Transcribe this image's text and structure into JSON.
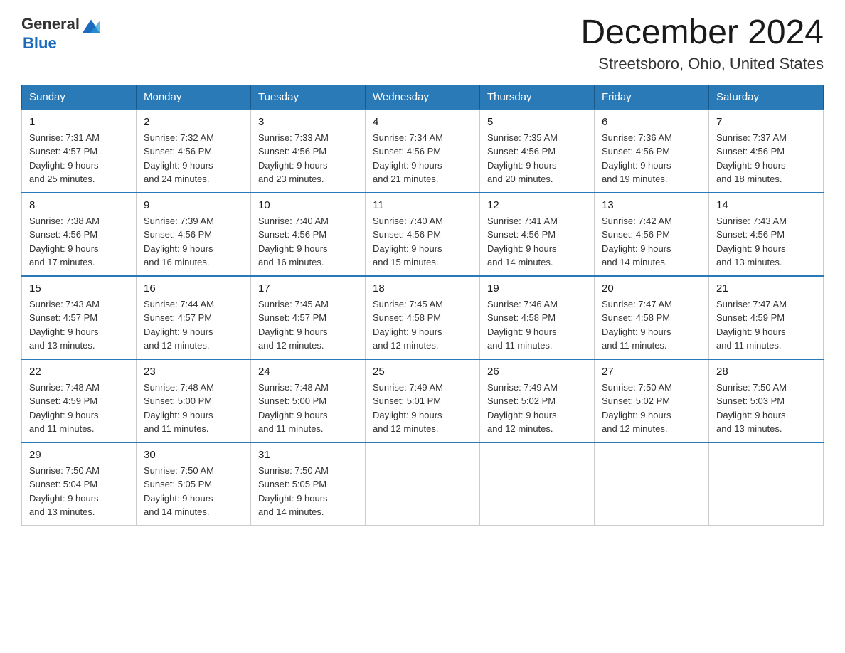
{
  "header": {
    "logo_general": "General",
    "logo_blue": "Blue",
    "title": "December 2024",
    "subtitle": "Streetsboro, Ohio, United States"
  },
  "weekdays": [
    "Sunday",
    "Monday",
    "Tuesday",
    "Wednesday",
    "Thursday",
    "Friday",
    "Saturday"
  ],
  "weeks": [
    [
      {
        "day": "1",
        "sunrise": "7:31 AM",
        "sunset": "4:57 PM",
        "daylight": "9 hours and 25 minutes."
      },
      {
        "day": "2",
        "sunrise": "7:32 AM",
        "sunset": "4:56 PM",
        "daylight": "9 hours and 24 minutes."
      },
      {
        "day": "3",
        "sunrise": "7:33 AM",
        "sunset": "4:56 PM",
        "daylight": "9 hours and 23 minutes."
      },
      {
        "day": "4",
        "sunrise": "7:34 AM",
        "sunset": "4:56 PM",
        "daylight": "9 hours and 21 minutes."
      },
      {
        "day": "5",
        "sunrise": "7:35 AM",
        "sunset": "4:56 PM",
        "daylight": "9 hours and 20 minutes."
      },
      {
        "day": "6",
        "sunrise": "7:36 AM",
        "sunset": "4:56 PM",
        "daylight": "9 hours and 19 minutes."
      },
      {
        "day": "7",
        "sunrise": "7:37 AM",
        "sunset": "4:56 PM",
        "daylight": "9 hours and 18 minutes."
      }
    ],
    [
      {
        "day": "8",
        "sunrise": "7:38 AM",
        "sunset": "4:56 PM",
        "daylight": "9 hours and 17 minutes."
      },
      {
        "day": "9",
        "sunrise": "7:39 AM",
        "sunset": "4:56 PM",
        "daylight": "9 hours and 16 minutes."
      },
      {
        "day": "10",
        "sunrise": "7:40 AM",
        "sunset": "4:56 PM",
        "daylight": "9 hours and 16 minutes."
      },
      {
        "day": "11",
        "sunrise": "7:40 AM",
        "sunset": "4:56 PM",
        "daylight": "9 hours and 15 minutes."
      },
      {
        "day": "12",
        "sunrise": "7:41 AM",
        "sunset": "4:56 PM",
        "daylight": "9 hours and 14 minutes."
      },
      {
        "day": "13",
        "sunrise": "7:42 AM",
        "sunset": "4:56 PM",
        "daylight": "9 hours and 14 minutes."
      },
      {
        "day": "14",
        "sunrise": "7:43 AM",
        "sunset": "4:56 PM",
        "daylight": "9 hours and 13 minutes."
      }
    ],
    [
      {
        "day": "15",
        "sunrise": "7:43 AM",
        "sunset": "4:57 PM",
        "daylight": "9 hours and 13 minutes."
      },
      {
        "day": "16",
        "sunrise": "7:44 AM",
        "sunset": "4:57 PM",
        "daylight": "9 hours and 12 minutes."
      },
      {
        "day": "17",
        "sunrise": "7:45 AM",
        "sunset": "4:57 PM",
        "daylight": "9 hours and 12 minutes."
      },
      {
        "day": "18",
        "sunrise": "7:45 AM",
        "sunset": "4:58 PM",
        "daylight": "9 hours and 12 minutes."
      },
      {
        "day": "19",
        "sunrise": "7:46 AM",
        "sunset": "4:58 PM",
        "daylight": "9 hours and 11 minutes."
      },
      {
        "day": "20",
        "sunrise": "7:47 AM",
        "sunset": "4:58 PM",
        "daylight": "9 hours and 11 minutes."
      },
      {
        "day": "21",
        "sunrise": "7:47 AM",
        "sunset": "4:59 PM",
        "daylight": "9 hours and 11 minutes."
      }
    ],
    [
      {
        "day": "22",
        "sunrise": "7:48 AM",
        "sunset": "4:59 PM",
        "daylight": "9 hours and 11 minutes."
      },
      {
        "day": "23",
        "sunrise": "7:48 AM",
        "sunset": "5:00 PM",
        "daylight": "9 hours and 11 minutes."
      },
      {
        "day": "24",
        "sunrise": "7:48 AM",
        "sunset": "5:00 PM",
        "daylight": "9 hours and 11 minutes."
      },
      {
        "day": "25",
        "sunrise": "7:49 AM",
        "sunset": "5:01 PM",
        "daylight": "9 hours and 12 minutes."
      },
      {
        "day": "26",
        "sunrise": "7:49 AM",
        "sunset": "5:02 PM",
        "daylight": "9 hours and 12 minutes."
      },
      {
        "day": "27",
        "sunrise": "7:50 AM",
        "sunset": "5:02 PM",
        "daylight": "9 hours and 12 minutes."
      },
      {
        "day": "28",
        "sunrise": "7:50 AM",
        "sunset": "5:03 PM",
        "daylight": "9 hours and 13 minutes."
      }
    ],
    [
      {
        "day": "29",
        "sunrise": "7:50 AM",
        "sunset": "5:04 PM",
        "daylight": "9 hours and 13 minutes."
      },
      {
        "day": "30",
        "sunrise": "7:50 AM",
        "sunset": "5:05 PM",
        "daylight": "9 hours and 14 minutes."
      },
      {
        "day": "31",
        "sunrise": "7:50 AM",
        "sunset": "5:05 PM",
        "daylight": "9 hours and 14 minutes."
      },
      null,
      null,
      null,
      null
    ]
  ],
  "labels": {
    "sunrise": "Sunrise:",
    "sunset": "Sunset:",
    "daylight": "Daylight:"
  }
}
